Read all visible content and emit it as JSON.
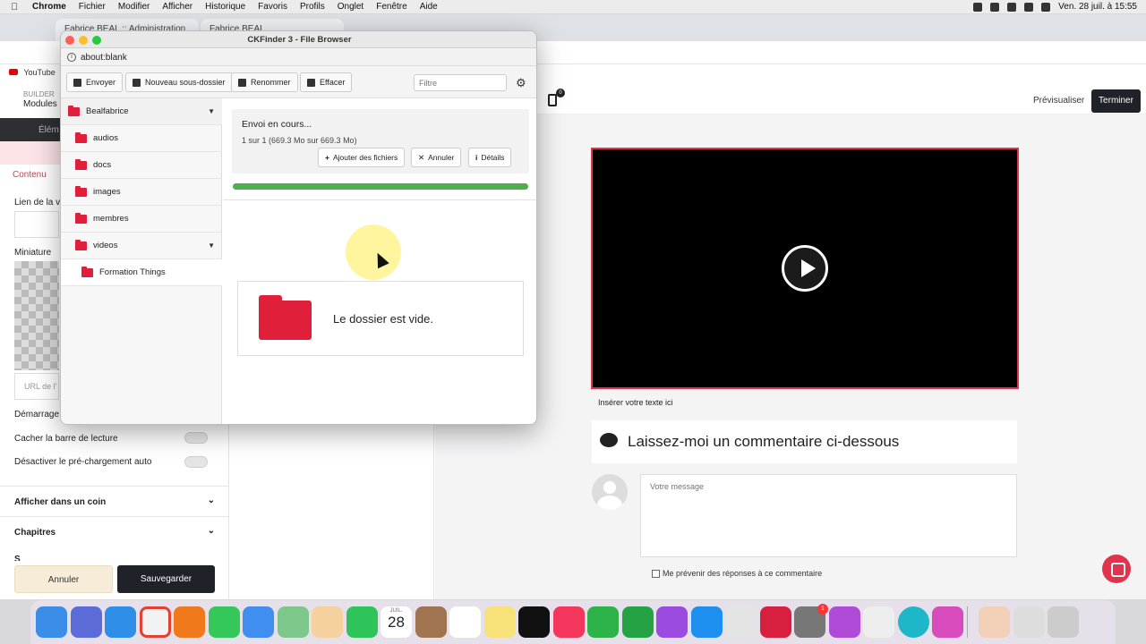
{
  "menubar": {
    "app": "Chrome",
    "items": [
      "Fichier",
      "Modifier",
      "Afficher",
      "Historique",
      "Favoris",
      "Profils",
      "Onglet",
      "Fenêtre",
      "Aide"
    ],
    "datetime": "Ven. 28 juil. à 15:55"
  },
  "browser": {
    "tabs": [
      "Fabrice BEAL :: Administration",
      "Fabrice BEAL"
    ],
    "bookmark": "YouTube"
  },
  "builder": {
    "brand": "BUILDER",
    "module_title": "Modules",
    "dark_label": "Élém",
    "tab_label": "Contenu",
    "field_video_link": "Lien de la v",
    "field_thumbnail": "Miniature",
    "url_placeholder": "URL de l'",
    "start_label": "Démarrage",
    "hide_bar_label": "Cacher la barre de lecture",
    "disable_preload_label": "Désactiver le pré-chargement auto",
    "accordions": [
      "Afficher dans un coin",
      "Chapitres"
    ],
    "partial_label": "S",
    "cancel": "Annuler",
    "save": "Sauvegarder"
  },
  "preview": {
    "preview_button": "Prévisualiser",
    "finish_button": "Terminer",
    "badge": "0",
    "insert_text": "Insérer votre texte ici",
    "comment_title": "Laissez-moi un commentaire ci-dessous",
    "message_placeholder": "Votre message",
    "notify_label": "Me prévenir des réponses à ce commentaire"
  },
  "ckfinder": {
    "title": "CKFinder 3 - File Browser",
    "url": "about:blank",
    "toolbar": {
      "upload": "Envoyer",
      "new_folder": "Nouveau sous-dossier",
      "rename": "Renommer",
      "delete": "Effacer",
      "filter_placeholder": "Filtre"
    },
    "tree": {
      "root": "Bealfabrice",
      "folders": [
        "audios",
        "docs",
        "images",
        "membres",
        "videos"
      ],
      "subfolder": "Formation Things"
    },
    "upload": {
      "status": "Envoi en cours...",
      "count": "1 sur 1 (669.3 Mo sur 669.3 Mo)",
      "add_files": "Ajouter des fichiers",
      "cancel": "Annuler",
      "details": "Détails",
      "progress": 1.0
    },
    "empty_message": "Le dossier est vide."
  },
  "dock": {
    "calendar_month": "JUIL.",
    "calendar_day": "28",
    "badge_count": "1"
  },
  "colors": {
    "accent_red": "#e0203a",
    "progress_green": "#4cb04f",
    "dark_button": "#1f2229"
  }
}
